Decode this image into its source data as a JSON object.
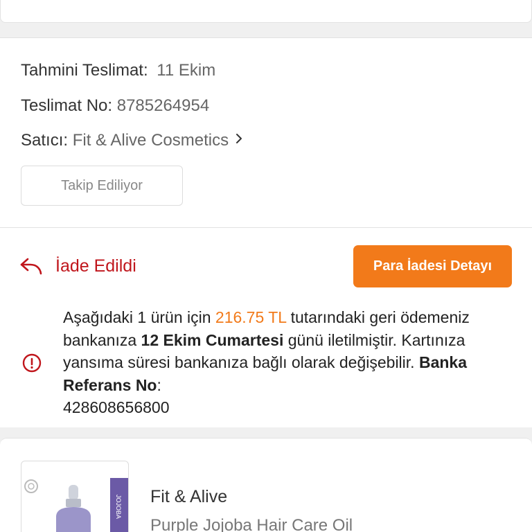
{
  "delivery": {
    "estimated_label": "Tahmini Teslimat:",
    "estimated_value": "11 Ekim",
    "number_label": "Teslimat No:",
    "number_value": "8785264954",
    "seller_label": "Satıcı:",
    "seller_value": "Fit & Alive Cosmetics",
    "follow_button": "Takip Ediliyor"
  },
  "refund": {
    "status_text": "İade Edildi",
    "detail_button": "Para İadesi Detayı",
    "message": {
      "part1": "Aşağıdaki 1 ürün için ",
      "amount": "216.75 TL",
      "part2": " tutarındaki geri ödemeniz bankanıza ",
      "date": "12 Ekim Cumartesi",
      "part3": " günü iletilmiştir. Kartınıza yansıma süresi bankanıza bağlı olarak değişebilir. ",
      "ref_label": "Banka Referans No",
      "part4": ":",
      "ref_no": "428608656800"
    }
  },
  "product": {
    "brand": "Fit & Alive",
    "name": "Purple Jojoba Hair Care Oil",
    "label_text": "JOJOBA"
  },
  "colors": {
    "accent_orange": "#f27a1a",
    "status_red": "#c0161c"
  },
  "icons": {
    "status": "return-arrow-icon",
    "info": "info-circle-icon",
    "seller": "chevron-right-icon"
  }
}
